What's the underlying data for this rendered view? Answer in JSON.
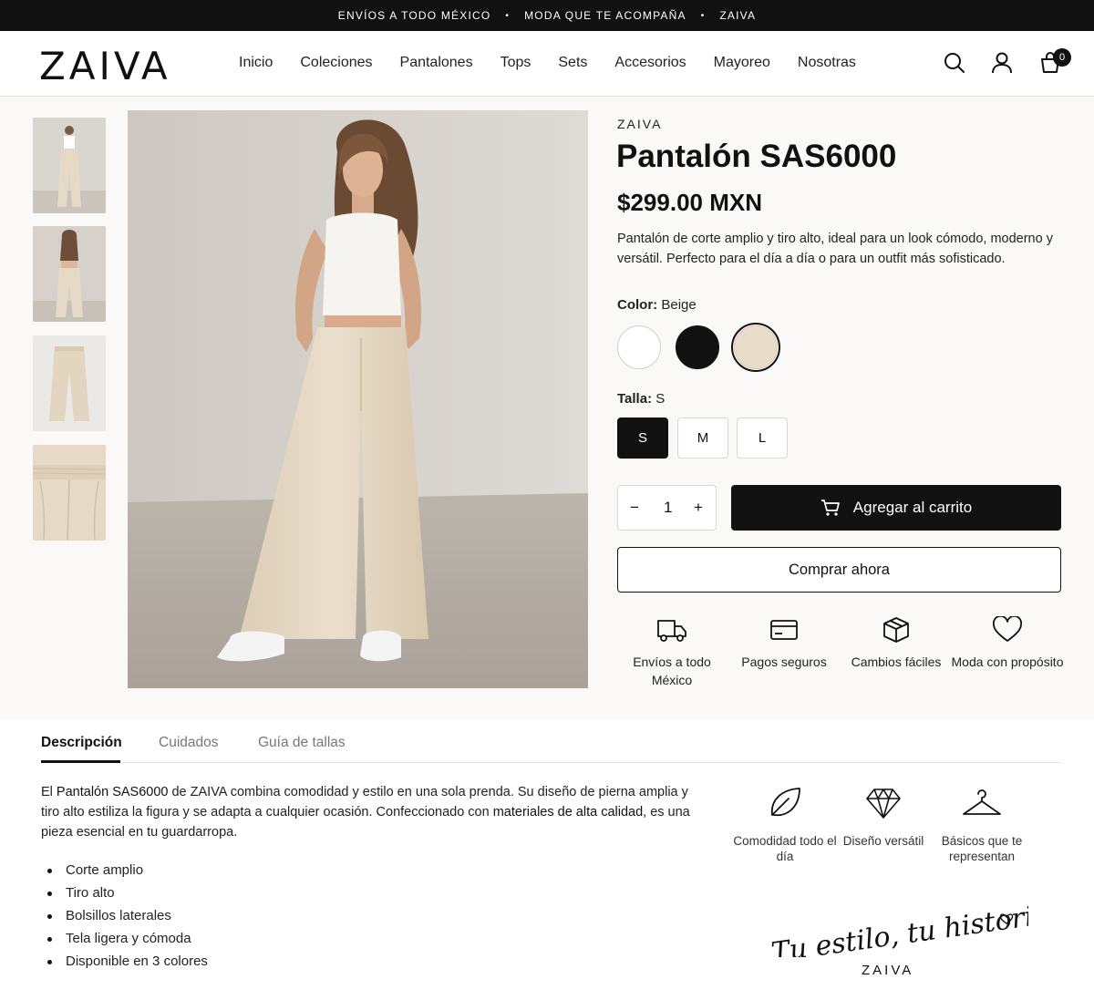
{
  "topbar": {
    "items": [
      "ENVÍOS A TODO MÉXICO",
      "MODA QUE TE ACOMPAÑA",
      "ZAIVA"
    ],
    "separator": "•"
  },
  "header": {
    "logo": "ZAIVA",
    "nav": [
      "Inicio",
      "Coleciones",
      "Pantalones",
      "Tops",
      "Sets",
      "Accesorios",
      "Mayoreo",
      "Nosotras"
    ],
    "icons": [
      "search-icon",
      "account-icon",
      "cart-icon"
    ],
    "cart_count": "0"
  },
  "product": {
    "brand": "ZAIVA",
    "title": "Pantalón SAS6000",
    "price": "$299.00 MXN",
    "description": "Pantalón de corte amplio y tiro alto, ideal para un look cómodo, moderno y versátil. Perfecto para el día a día o para un outfit más sofisticado.",
    "color_label": "Color:",
    "color_value": "Beige",
    "colors": [
      {
        "name": "Blanco",
        "hex": "#ffffff"
      },
      {
        "name": "Negro",
        "hex": "#111111"
      },
      {
        "name": "Beige",
        "hex": "#e8dccb",
        "selected": true
      }
    ],
    "size_label": "Talla:",
    "size_value": "S",
    "sizes": [
      "S",
      "M",
      "L"
    ],
    "quantity": "1",
    "qty_minus": "−",
    "qty_plus": "+",
    "add_to_cart": "Agregar al carrito",
    "buy_now": "Comprar ahora",
    "features": [
      {
        "icon": "truck-icon",
        "label": "Envíos a todo México"
      },
      {
        "icon": "credit-card-icon",
        "label": "Pagos seguros"
      },
      {
        "icon": "box-icon",
        "label": "Cambios fáciles"
      },
      {
        "icon": "heart-icon",
        "label": "Moda con propósito"
      }
    ]
  },
  "tabs": {
    "items": [
      "Descripción",
      "Cuidados",
      "Guía de tallas"
    ],
    "active": "Descripción"
  },
  "details": {
    "p_part1": "El ",
    "p_bold1": "Pantalón SAS6000",
    "p_part2": " de ZAIVA combina comodidad y estilo en una sola prenda. Su diseño de pierna amplia y tiro alto estiliza la figura y se adapta a cualquier ocasión. Confeccionado con ",
    "p_bold2": "materiales de alta calidad",
    "p_part3": ", es una pieza esencial en tu guardarropa.",
    "bullets": [
      "Corte amplio",
      "Tiro alto",
      "Bolsillos laterales",
      "Tela ligera y cómoda",
      "Disponible en 3 colores"
    ],
    "values": [
      {
        "icon": "leaf-icon",
        "label": "Comodidad todo el día"
      },
      {
        "icon": "diamond-icon",
        "label": "Diseño versátil"
      },
      {
        "icon": "hanger-icon",
        "label": "Básicos que te representan"
      }
    ],
    "tagline": "Tu estilo, tu historia",
    "tagline_brand": "ZAIVA"
  }
}
